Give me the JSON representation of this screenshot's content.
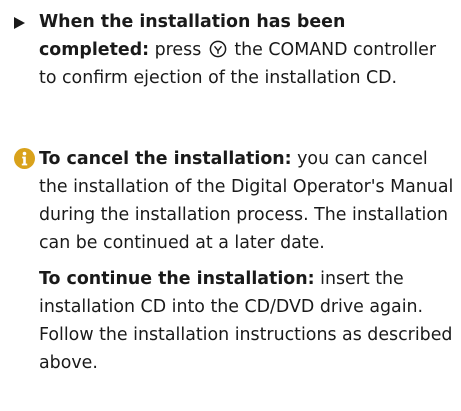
{
  "step": {
    "lead": "When the installation has been completed:",
    "text_before_icon": "press",
    "icon": "comand-controller-press-icon",
    "text_after_icon": "the COMAND controller to confirm ejection of the installation CD."
  },
  "note": {
    "icon": "info-icon",
    "icon_color": "#d9a21b",
    "cancel_lead": "To cancel the installation:",
    "cancel_text": "you can cancel the installation of the Digital Operator's Manual during the installation process. The installation can be continued at a later date.",
    "continue_lead": "To continue the installation:",
    "continue_text": "insert the installation CD into the CD/DVD drive again. Follow the installation instructions as described above."
  }
}
